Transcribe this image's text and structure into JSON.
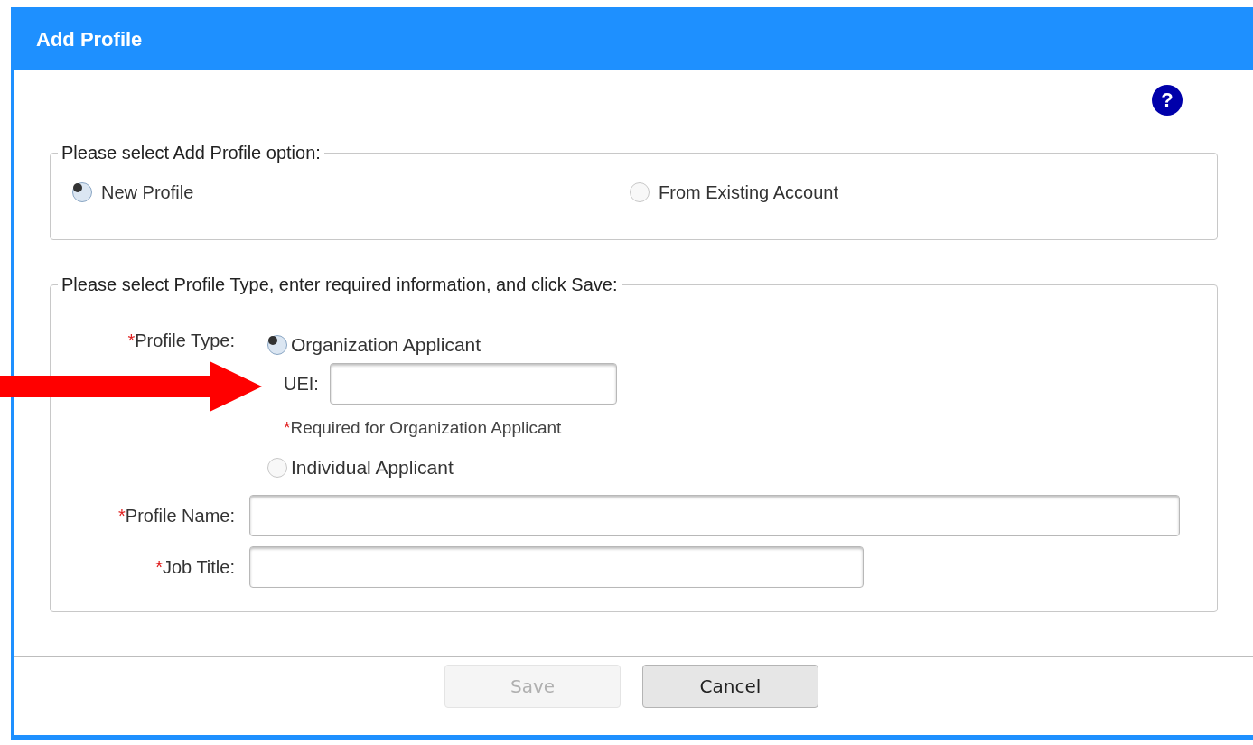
{
  "dialog": {
    "title": "Add Profile",
    "help": "?"
  },
  "option_group": {
    "legend": "Please select Add Profile option:",
    "options": [
      {
        "label": "New Profile",
        "selected": true
      },
      {
        "label": "From Existing Account",
        "selected": false
      }
    ]
  },
  "profile_group": {
    "legend": "Please select Profile Type, enter required information, and click Save:",
    "profile_type": {
      "asterisk": "*",
      "label": "Profile Type:",
      "options": [
        {
          "label": "Organization Applicant",
          "selected": true
        },
        {
          "label": "Individual Applicant",
          "selected": false
        }
      ]
    },
    "uei": {
      "label": "UEI:",
      "note_asterisk": "*",
      "note": "Required for Organization Applicant"
    },
    "fields": [
      {
        "asterisk": "*",
        "label": "Profile Name:"
      },
      {
        "asterisk": "*",
        "label": "Job Title:"
      }
    ]
  },
  "buttons": [
    {
      "label": "Save",
      "disabled": true
    },
    {
      "label": "Cancel",
      "disabled": false
    }
  ]
}
